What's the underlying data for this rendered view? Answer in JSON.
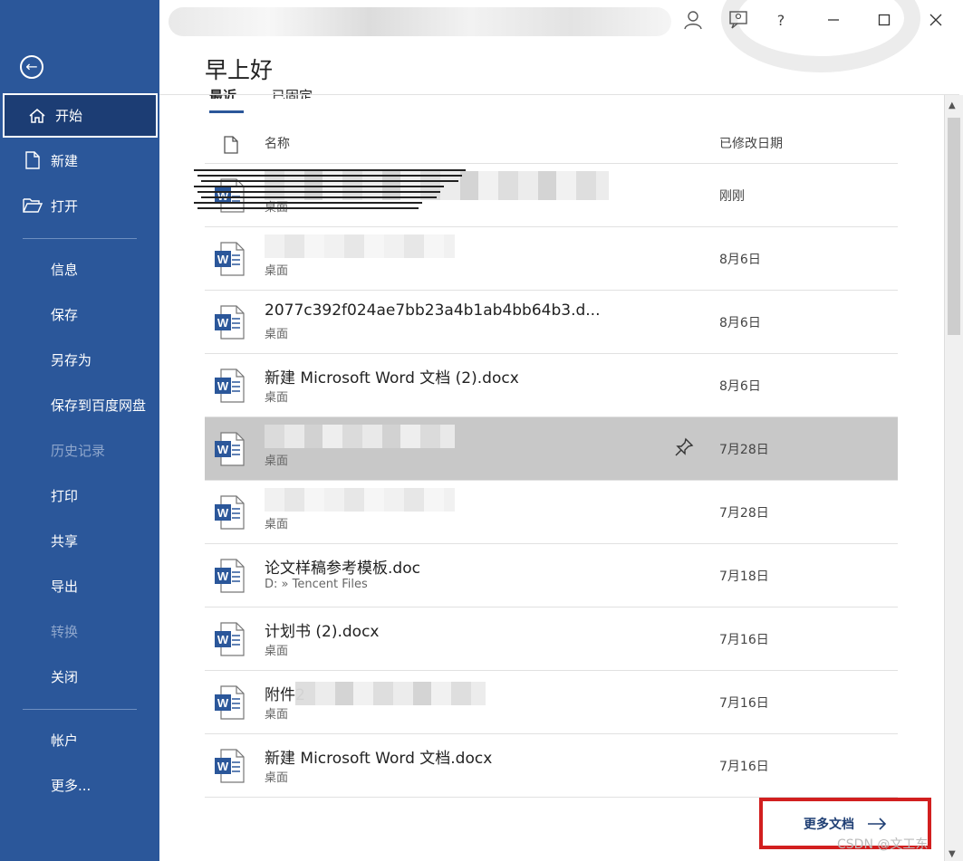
{
  "sidebar": {
    "active_item": "开始",
    "top_items": [
      "开始",
      "新建",
      "打开"
    ],
    "items": [
      "信息",
      "保存",
      "另存为",
      "保存到百度网盘",
      "历史记录",
      "打印",
      "共享",
      "导出",
      "转换",
      "关闭"
    ],
    "disabled_items": [
      "历史记录",
      "转换"
    ],
    "bottom_items": [
      "帐户",
      "更多..."
    ]
  },
  "titlebar": {
    "help": "?"
  },
  "greeting": "早上好",
  "tabs": {
    "recent": "最近",
    "pinned": "已固定"
  },
  "columns": {
    "name": "名称",
    "modified": "已修改日期"
  },
  "files": [
    {
      "name": "",
      "location": "桌面",
      "date": "刚刚",
      "redacted": true
    },
    {
      "name": "",
      "location": "桌面",
      "date": "8月6日",
      "redacted": true
    },
    {
      "name": "2077c392f024ae7bb23a4b1ab4bb64b3.d...",
      "location": "桌面",
      "date": "8月6日"
    },
    {
      "name": "新建 Microsoft Word 文档 (2).docx",
      "location": "桌面",
      "date": "8月6日"
    },
    {
      "name": "",
      "location": "桌面",
      "date": "7月28日",
      "redacted": true,
      "selected": true,
      "pinned": true
    },
    {
      "name": "",
      "location": "桌面",
      "date": "7月28日",
      "redacted": true
    },
    {
      "name": "论文样稿参考模板.doc",
      "location": "D: » Tencent Files",
      "date": "7月18日"
    },
    {
      "name": "计划书 (2).docx",
      "location": "桌面",
      "date": "7月16日"
    },
    {
      "name": "附件2",
      "location": "桌面",
      "date": "7月16日",
      "redacted": true
    },
    {
      "name": "新建 Microsoft Word 文档.docx",
      "location": "桌面",
      "date": "7月16日"
    }
  ],
  "more_documents": "更多文档",
  "watermark": "CSDN @文工东",
  "colors": {
    "sidebar": "#2b579a",
    "selected_row": "#c8c8c8",
    "highlight_box": "#d21f1f"
  }
}
